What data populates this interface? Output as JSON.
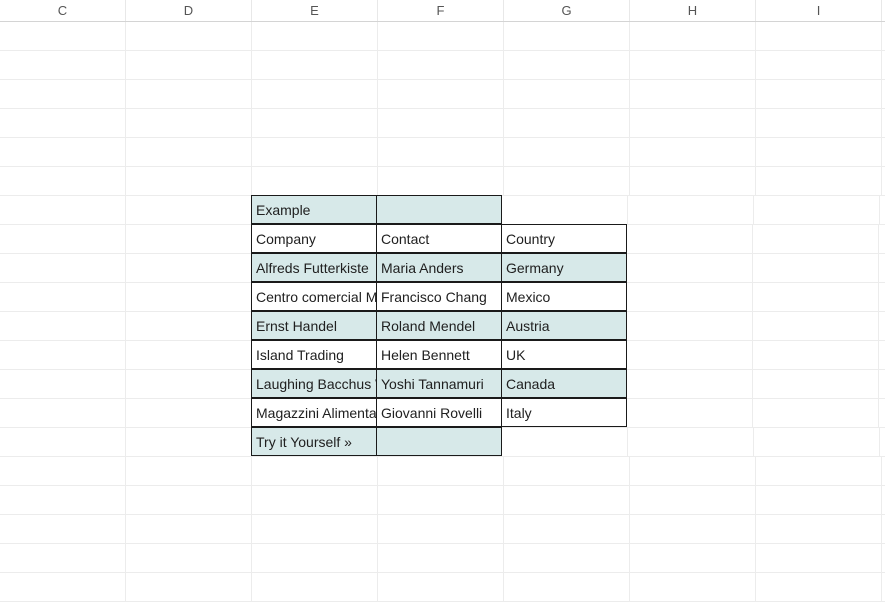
{
  "columns": [
    "C",
    "D",
    "E",
    "F",
    "G",
    "H",
    "I"
  ],
  "content": {
    "title": "Example",
    "headers": {
      "company": "Company",
      "contact": "Contact",
      "country": "Country"
    },
    "rows": [
      {
        "company": "Alfreds Futterkiste",
        "contact": "Maria Anders",
        "country": "Germany"
      },
      {
        "company": "Centro comercial Moctezuma",
        "contact": "Francisco Chang",
        "country": "Mexico"
      },
      {
        "company": "Ernst Handel",
        "contact": "Roland Mendel",
        "country": "Austria"
      },
      {
        "company": "Island Trading",
        "contact": "Helen Bennett",
        "country": "UK"
      },
      {
        "company": "Laughing Bacchus Winecellars",
        "contact": "Yoshi Tannamuri",
        "country": "Canada"
      },
      {
        "company": "Magazzini Alimentari Riuniti",
        "contact": "Giovanni Rovelli",
        "country": "Italy"
      }
    ],
    "footer": "Try it Yourself »"
  },
  "gridRows": 20
}
